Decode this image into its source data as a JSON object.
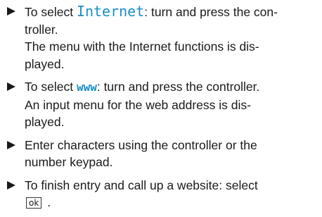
{
  "steps": [
    {
      "pre": "To select ",
      "keyword": "Internet",
      "post": ": turn and press the con-",
      "line2": "troller.",
      "result1": "The menu with the Internet functions is dis-",
      "result2": "played."
    },
    {
      "pre": "To select ",
      "keyword": "www",
      "post": ": turn and press the controller.",
      "result1": "An input menu for the web address is dis-",
      "result2": "played."
    },
    {
      "line1": "Enter characters using the controller or the",
      "line2": "number keypad."
    },
    {
      "line1": "To finish entry and call up a website: select",
      "key_label": "ok",
      "end": "."
    }
  ]
}
